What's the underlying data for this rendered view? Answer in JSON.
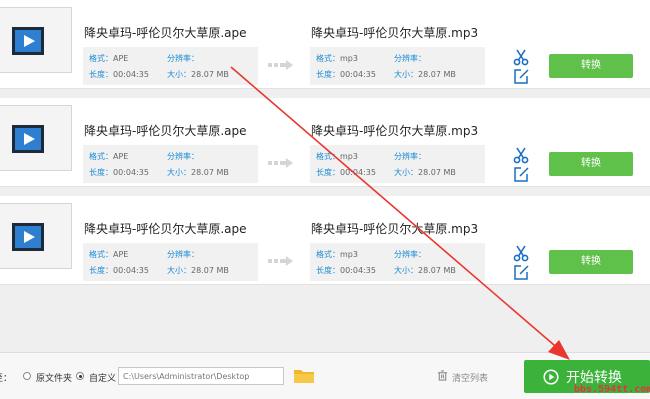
{
  "colors": {
    "accent_blue": "#1a8bd6",
    "convert_green": "#5fc04a",
    "start_green": "#3bb33a",
    "annotation_red": "#e8372f"
  },
  "files": [
    {
      "src_name": "降央卓玛-呼伦贝尔大草原.ape",
      "src_format_label": "格式：",
      "src_format": "APE",
      "src_res_label": "分辨率：",
      "src_res": "",
      "src_duration_label": "长度：",
      "src_duration": "00:04:35",
      "src_size_label": "大小：",
      "src_size": "28.07 MB",
      "dst_name": "降央卓玛-呼伦贝尔大草原.mp3",
      "dst_format_label": "格式：",
      "dst_format": "mp3",
      "dst_res_label": "分辨率：",
      "dst_res": "",
      "dst_duration_label": "长度：",
      "dst_duration": "00:04:35",
      "dst_size_label": "大小：",
      "dst_size": "28.07 MB",
      "convert_label": "转换"
    },
    {
      "src_name": "降央卓玛-呼伦贝尔大草原.ape",
      "src_format_label": "格式：",
      "src_format": "APE",
      "src_res_label": "分辨率：",
      "src_res": "",
      "src_duration_label": "长度：",
      "src_duration": "00:04:35",
      "src_size_label": "大小：",
      "src_size": "28.07 MB",
      "dst_name": "降央卓玛-呼伦贝尔大草原.mp3",
      "dst_format_label": "格式：",
      "dst_format": "mp3",
      "dst_res_label": "分辨率：",
      "dst_res": "",
      "dst_duration_label": "长度：",
      "dst_duration": "00:04:35",
      "dst_size_label": "大小：",
      "dst_size": "28.07 MB",
      "convert_label": "转换"
    },
    {
      "src_name": "降央卓玛-呼伦贝尔大草原.ape",
      "src_format_label": "格式：",
      "src_format": "APE",
      "src_res_label": "分辨率：",
      "src_res": "",
      "src_duration_label": "长度：",
      "src_duration": "00:04:35",
      "src_size_label": "大小：",
      "src_size": "28.07 MB",
      "dst_name": "降央卓玛-呼伦贝尔大草原.mp3",
      "dst_format_label": "格式：",
      "dst_format": "mp3",
      "dst_res_label": "分辨率：",
      "dst_res": "",
      "dst_duration_label": "长度：",
      "dst_duration": "00:04:35",
      "dst_size_label": "大小：",
      "dst_size": "28.07 MB",
      "convert_label": "转换"
    }
  ],
  "footer": {
    "output_label": "至：",
    "radio_original_label": "原文件夹",
    "radio_custom_label": "自定义",
    "selected": "custom",
    "path_value": "C:\\Users\\Administrator\\Desktop",
    "clear_label": "清空列表",
    "start_label": "开始转换"
  },
  "icons": {
    "thumb": "film-icon",
    "arrows": "triple-arrow-icon",
    "cut": "scissors-icon",
    "edit": "edit-icon",
    "folder": "folder-icon",
    "trash": "trash-icon",
    "play": "play-circle-icon"
  },
  "watermark": "bbs.594tt.com"
}
